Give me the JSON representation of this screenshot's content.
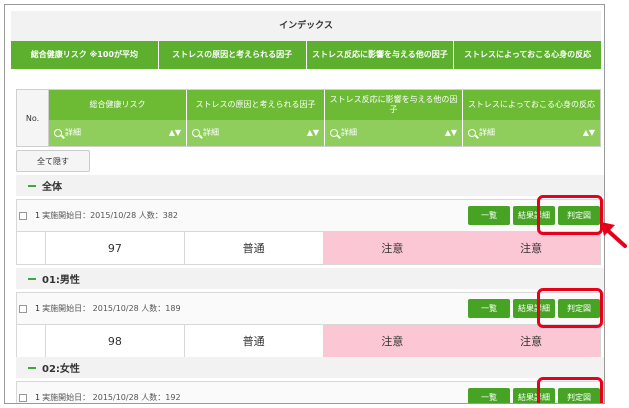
{
  "index": {
    "title": "インデックス",
    "tabs": [
      "総合健康リスク ※100が平均",
      "ストレスの原因と考えられる因子",
      "ストレス反応に影響を与える他の因子",
      "ストレスによっておこる心身の反応"
    ]
  },
  "table": {
    "no_label": "No.",
    "columns": [
      {
        "label": "総合健康リスク",
        "search": "詳細"
      },
      {
        "label": "ストレスの原因と考えられる因子",
        "search": "詳細"
      },
      {
        "label": "ストレス反応に影響を与える他の因子",
        "search": "詳細"
      },
      {
        "label": "ストレスによっておこる心身の反応",
        "search": "詳細"
      }
    ],
    "sort_glyph": "▲▼"
  },
  "collapse_label": "全て隠す",
  "groups": [
    {
      "title": "全体",
      "no": "1",
      "meta": "実施開始日：2015/10/28  人数：382",
      "values": [
        "97",
        "普通",
        "注意",
        "注意"
      ]
    },
    {
      "title": "01:男性",
      "no": "1",
      "meta": "実施開始日： 2015/10/28  人数：189",
      "values": [
        "98",
        "普通",
        "注意",
        "注意"
      ]
    },
    {
      "title": "02:女性",
      "no": "1",
      "meta": "実施開始日： 2015/10/28  人数：192",
      "values": []
    }
  ],
  "buttons": {
    "list": "一覧",
    "results": "結果詳細",
    "judge": "判定図"
  },
  "colors": {
    "green": "#46a324",
    "warn": "#fbc7d4",
    "highlight": "#e8001b"
  }
}
